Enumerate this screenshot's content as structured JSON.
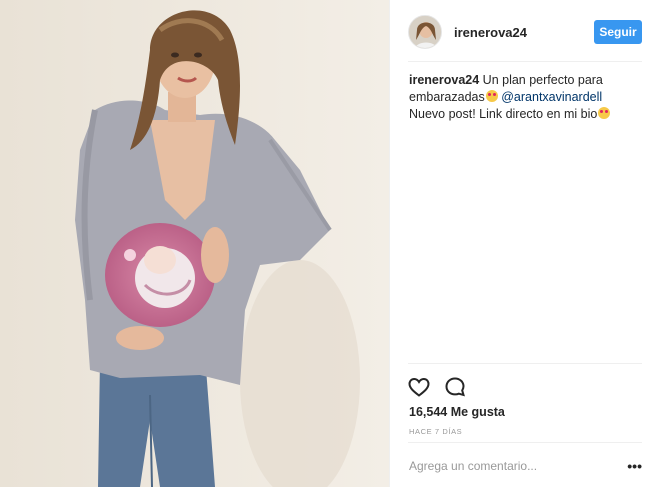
{
  "post": {
    "username": "irenerova24",
    "follow_label": "Seguir",
    "caption": {
      "username": "irenerova24",
      "line1": "Un plan perfecto para",
      "line2": "embarazadas",
      "mention": "@arantxavinardell",
      "line3": "Nuevo post! Link directo en mi bio"
    },
    "icons": {
      "like": "heart-icon",
      "comment": "comment-icon",
      "more": "more-options-icon"
    },
    "likes": "16,544 Me gusta",
    "timestamp": "HACE 7 DÍAS",
    "comment_placeholder": "Agrega un comentario...",
    "more_label": "•••"
  },
  "colors": {
    "follow_button": "#3897f0",
    "link": "#003569",
    "divider": "#efefef"
  }
}
